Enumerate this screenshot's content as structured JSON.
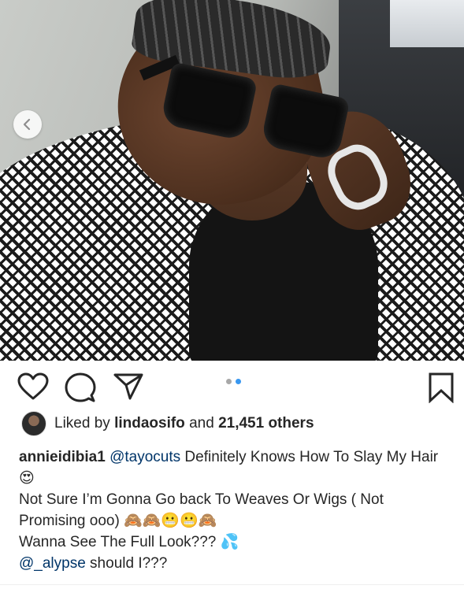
{
  "post": {
    "carousel_total": 2,
    "carousel_active_index": 1,
    "likes": {
      "prefix": "Liked by",
      "liker": "lindaosifo",
      "connector": "and",
      "count_text": "21,451 others"
    },
    "caption": {
      "username": "annieidibia1",
      "mention1": "@tayocuts",
      "line1_rest": " Definitely Knows How To Slay My Hair",
      "line1_emoji": "😍",
      "line2": "Not Sure I’m Gonna Go back To Weaves Or Wigs ( Not Promising ooo) ",
      "line2_emoji": "🙈🙈😬😬🙈",
      "line3": "Wanna See The Full Look??? ",
      "line3_emoji": "💦",
      "mention2": "@_alypse",
      "line4_rest": " should I???"
    }
  },
  "icons": {
    "like": "heart-icon",
    "comment": "comment-icon",
    "share": "direct-share-icon",
    "save": "bookmark-icon",
    "carousel_prev": "chevron-left-icon"
  },
  "colors": {
    "accent": "#3897f0",
    "mention": "#003569",
    "text": "#262626"
  }
}
